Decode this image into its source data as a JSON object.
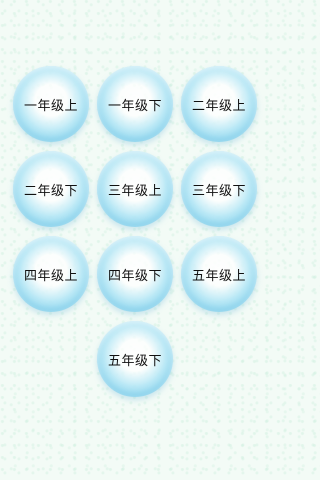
{
  "grades": [
    {
      "label": "一年级上"
    },
    {
      "label": "一年级下"
    },
    {
      "label": "二年级上"
    },
    {
      "label": "二年级下"
    },
    {
      "label": "三年级上"
    },
    {
      "label": "三年级下"
    },
    {
      "label": "四年级上"
    },
    {
      "label": "四年级下"
    },
    {
      "label": "五年级上"
    },
    {
      "label": "五年级下"
    }
  ],
  "colors": {
    "background": "#f3fbf6",
    "button_edge": "#6ec8ea",
    "button_center": "#ffffff",
    "text": "#111111"
  }
}
